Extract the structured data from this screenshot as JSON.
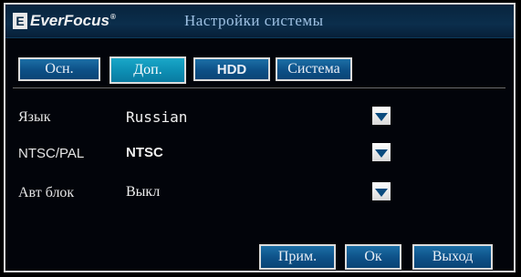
{
  "header": {
    "logo_mark": "E",
    "logo_text": "EverFocus",
    "logo_reg": "®",
    "title": "Настройки системы"
  },
  "tabs": [
    {
      "label": "Осн.",
      "active": false
    },
    {
      "label": "Доп.",
      "active": true
    },
    {
      "label": "HDD",
      "active": false
    },
    {
      "label": "Система",
      "active": false
    }
  ],
  "settings": [
    {
      "label": "Язык",
      "value": "Russian"
    },
    {
      "label": "NTSC/PAL",
      "value": "NTSC"
    },
    {
      "label": "Авт блок",
      "value": "Выкл"
    }
  ],
  "buttons": {
    "apply": "Прим.",
    "ok": "Ок",
    "exit": "Выход"
  },
  "colors": {
    "tab_active": "#0d8eb3",
    "tab_inactive": "#0d5087",
    "title_bar": "#0b2e4c",
    "title_text": "#9fc1e3",
    "dropdown_arrow": "#0a4b7e"
  }
}
